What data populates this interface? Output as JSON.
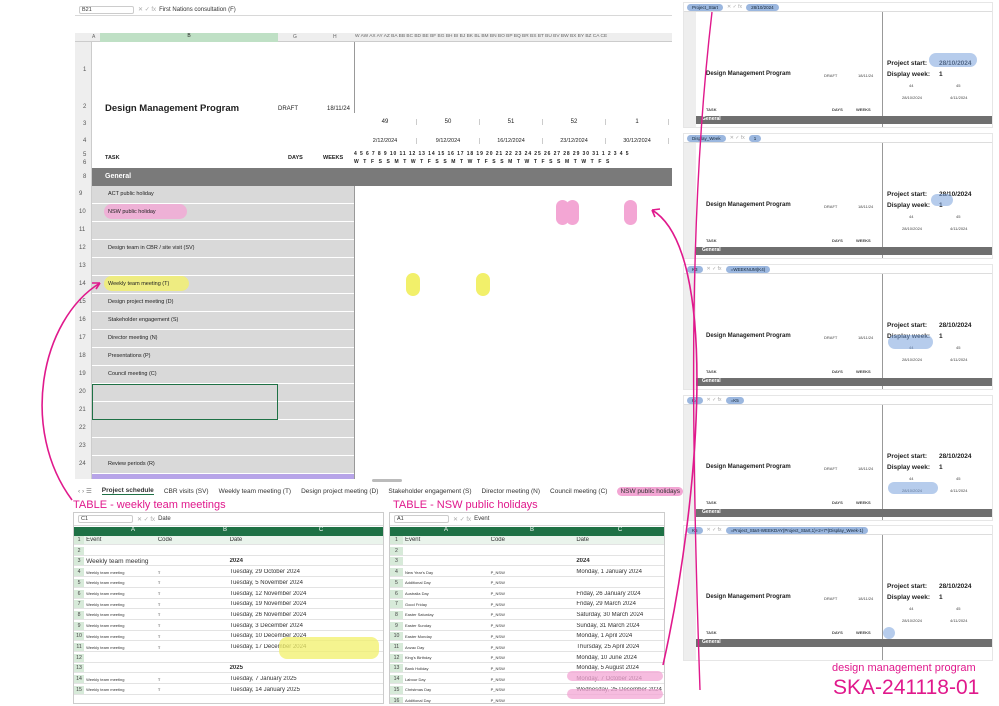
{
  "main": {
    "namebox": "B21",
    "formula": "First Nations consultation (F)",
    "title": "Design Management Program",
    "status": "DRAFT",
    "date": "18/11/24",
    "col_headers": [
      "A",
      "B",
      "G",
      "H"
    ],
    "right_col_headers": "W AW AX AY AZ BA BB BC BD BE BF BG BH BI BJ BK BL BM BN BO BP BQ BR BS BT BU BV BW BX BY BZ CA CE",
    "weeks": [
      "49",
      "50",
      "51",
      "52",
      "1"
    ],
    "week_dates": [
      "2/12/2024",
      "9/12/2024",
      "16/12/2024",
      "23/12/2024",
      "30/12/2024"
    ],
    "day_numbers": "4 5 6 7 8 9 10 11 12 13 14 15 16 17 18 19 20 21 22 23 24 25 26 27 28 29 30 31 1 2 3 4 5",
    "day_letters": "W T F S S M T W T F S S M T W T F S S M T W T F S S M T W T F S",
    "task_header": "TASK",
    "days_header": "DAYS",
    "weeks_header": "WEEKS",
    "section": "General",
    "rows": [
      {
        "n": "9",
        "label": "ACT public holiday"
      },
      {
        "n": "10",
        "label": "NSW public holiday"
      },
      {
        "n": "11",
        "label": ""
      },
      {
        "n": "12",
        "label": "Design team in CBR / site visit (SV)"
      },
      {
        "n": "13",
        "label": ""
      },
      {
        "n": "14",
        "label": "Weekly team meeting (T)"
      },
      {
        "n": "15",
        "label": "Design project meeting (D)"
      },
      {
        "n": "16",
        "label": "Stakeholder engagement (S)"
      },
      {
        "n": "17",
        "label": "Director meeting (N)"
      },
      {
        "n": "18",
        "label": "Presentations (P)"
      },
      {
        "n": "19",
        "label": "Council meeting (C)"
      },
      {
        "n": "20",
        "label": ""
      },
      {
        "n": "21",
        "label": ""
      },
      {
        "n": "22",
        "label": ""
      },
      {
        "n": "23",
        "label": ""
      },
      {
        "n": "24",
        "label": "Review periods (R)"
      }
    ],
    "row_numbers_top": [
      "1",
      "2",
      "3",
      "4",
      "5",
      "6",
      "7",
      "8"
    ]
  },
  "tabs": [
    "Project schedule",
    "CBR visits (SV)",
    "Weekly team meeting (T)",
    "Design project meeting (D)",
    "Stakeholder engagement (S)",
    "Director meeting (N)",
    "Council meeting (C)",
    "NSW public holidays"
  ],
  "annotations": {
    "weekly": "TABLE - weekly team meetings",
    "nsw": "TABLE - NSW public holidays",
    "footer_label": "design management program",
    "footer_code": "SKA-241118-01"
  },
  "colors": {
    "magenta": "#e0198c",
    "green": "#1e7145",
    "yellow": "#f2f06a",
    "pink": "#f3a6d4",
    "grey": "#d9d9d9"
  },
  "weekly_table": {
    "namebox": "C1",
    "formula": "Date",
    "cols": [
      "A",
      "B",
      "C"
    ],
    "headers": [
      "Event",
      "Code",
      "Date"
    ],
    "rows": [
      {
        "n": "1",
        "a": "Event",
        "b": "Code",
        "c": "Date"
      },
      {
        "n": "2",
        "a": "",
        "b": "",
        "c": ""
      },
      {
        "n": "3",
        "a": "Weekly team meeting",
        "b": "",
        "c": "2024"
      },
      {
        "n": "4",
        "a": "Weekly team meeting",
        "b": "T",
        "c": "Tuesday, 29 October 2024"
      },
      {
        "n": "5",
        "a": "Weekly team meeting",
        "b": "T",
        "c": "Tuesday, 5 November 2024"
      },
      {
        "n": "6",
        "a": "Weekly team meeting",
        "b": "T",
        "c": "Tuesday, 12 November 2024"
      },
      {
        "n": "7",
        "a": "Weekly team meeting",
        "b": "T",
        "c": "Tuesday, 19 November 2024"
      },
      {
        "n": "8",
        "a": "Weekly team meeting",
        "b": "T",
        "c": "Tuesday, 26 November 2024"
      },
      {
        "n": "9",
        "a": "Weekly team meeting",
        "b": "T",
        "c": "Tuesday, 3 December 2024"
      },
      {
        "n": "10",
        "a": "Weekly team meeting",
        "b": "T",
        "c": "Tuesday, 10 December 2024"
      },
      {
        "n": "11",
        "a": "Weekly team meeting",
        "b": "T",
        "c": "Tuesday, 17 December 2024"
      },
      {
        "n": "12",
        "a": "",
        "b": "",
        "c": ""
      },
      {
        "n": "13",
        "a": "",
        "b": "",
        "c": "2025"
      },
      {
        "n": "14",
        "a": "Weekly team meeting",
        "b": "T",
        "c": "Tuesday, 7 January 2025"
      },
      {
        "n": "15",
        "a": "Weekly team meeting",
        "b": "T",
        "c": "Tuesday, 14 January 2025"
      }
    ]
  },
  "nsw_table": {
    "namebox": "A1",
    "formula": "Event",
    "cols": [
      "A",
      "B",
      "C"
    ],
    "rows": [
      {
        "n": "1",
        "a": "Event",
        "b": "Code",
        "c": "Date"
      },
      {
        "n": "2",
        "a": "",
        "b": "",
        "c": ""
      },
      {
        "n": "3",
        "a": "",
        "b": "",
        "c": "2024"
      },
      {
        "n": "4",
        "a": "New Year's Day",
        "b": "P_NSW",
        "c": "Monday, 1 January 2024"
      },
      {
        "n": "5",
        "a": "Additional Day",
        "b": "P_NSW",
        "c": ""
      },
      {
        "n": "6",
        "a": "Australia Day",
        "b": "P_NSW",
        "c": "Friday, 26 January 2024"
      },
      {
        "n": "7",
        "a": "Good Friday",
        "b": "P_NSW",
        "c": "Friday, 29 March 2024"
      },
      {
        "n": "8",
        "a": "Easter Saturday",
        "b": "P_NSW",
        "c": "Saturday, 30 March 2024"
      },
      {
        "n": "9",
        "a": "Easter Sunday",
        "b": "P_NSW",
        "c": "Sunday, 31 March 2024"
      },
      {
        "n": "10",
        "a": "Easter Monday",
        "b": "P_NSW",
        "c": "Monday, 1 April 2024"
      },
      {
        "n": "11",
        "a": "Anzac Day",
        "b": "P_NSW",
        "c": "Thursday, 25 April 2024"
      },
      {
        "n": "12",
        "a": "King's Birthday",
        "b": "P_NSW",
        "c": "Monday, 10 June 2024"
      },
      {
        "n": "13",
        "a": "Bank Holiday",
        "b": "P_NSW",
        "c": "Monday, 5 August 2024"
      },
      {
        "n": "14",
        "a": "Labour Day",
        "b": "P_NSW",
        "c": "Monday, 7 October 2024"
      },
      {
        "n": "15",
        "a": "Christmas Day",
        "b": "P_NSW",
        "c": "Wednesday, 25 December 2024"
      },
      {
        "n": "16",
        "a": "Additional Day",
        "b": "P_NSW",
        "c": ""
      },
      {
        "n": "17",
        "a": "Boxing Day",
        "b": "P_NSW",
        "c": "Thursday, 26 December 2024"
      }
    ]
  },
  "thumbs": [
    {
      "namebox": "Project_Start",
      "formula": "28/10/2024",
      "title": "Design Management Program",
      "status": "DRAFT",
      "date": "18/11/24",
      "ps_label": "Project start:",
      "ps_value": "28/10/2024",
      "dw_label": "Display week:",
      "dw_value": "1",
      "w1": "44",
      "w2": "45",
      "d1": "28/10/2024",
      "d2": "4/11/2024",
      "task": "TASK",
      "days": "DAYS",
      "weeks": "WEEKS",
      "general": "General"
    },
    {
      "namebox": "Display_Week",
      "formula": "1",
      "title": "Design Management Program",
      "status": "DRAFT",
      "date": "18/11/24",
      "ps_label": "Project start:",
      "ps_value": "28/10/2024",
      "dw_label": "Display week:",
      "dw_value": "1",
      "w1": "44",
      "w2": "45",
      "d1": "28/10/2024",
      "d2": "4/11/2024",
      "task": "TASK",
      "days": "DAYS",
      "weeks": "WEEKS",
      "general": "General"
    },
    {
      "namebox": "K3",
      "formula": "=WEEKNUM(K4)",
      "title": "Design Management Program",
      "status": "DRAFT",
      "date": "18/11/24",
      "ps_label": "Project start:",
      "ps_value": "28/10/2024",
      "dw_label": "Display week:",
      "dw_value": "1",
      "w1": "44",
      "w2": "45",
      "d1": "28/10/2024",
      "d2": "4/11/2024",
      "task": "TASK",
      "days": "DAYS",
      "weeks": "WEEKS",
      "general": "General"
    },
    {
      "namebox": "K4",
      "formula": "=K5",
      "title": "Design Management Program",
      "status": "DRAFT",
      "date": "18/11/24",
      "ps_label": "Project start:",
      "ps_value": "28/10/2024",
      "dw_label": "Display week:",
      "dw_value": "1",
      "w1": "44",
      "w2": "45",
      "d1": "28/10/2024",
      "d2": "4/11/2024",
      "task": "TASK",
      "days": "DAYS",
      "weeks": "WEEKS",
      "general": "General"
    },
    {
      "namebox": "K5",
      "formula": "=Project_Start-WEEKDAY(Project_Start,1)+2+7*(Display_Week-1)",
      "title": "Design Management Program",
      "status": "DRAFT",
      "date": "18/11/24",
      "ps_label": "Project start:",
      "ps_value": "28/10/2024",
      "dw_label": "Display week:",
      "dw_value": "1",
      "w1": "44",
      "w2": "45",
      "d1": "28/10/2024",
      "d2": "4/11/2024",
      "task": "TASK",
      "days": "DAYS",
      "weeks": "WEEKS",
      "general": "General"
    }
  ]
}
